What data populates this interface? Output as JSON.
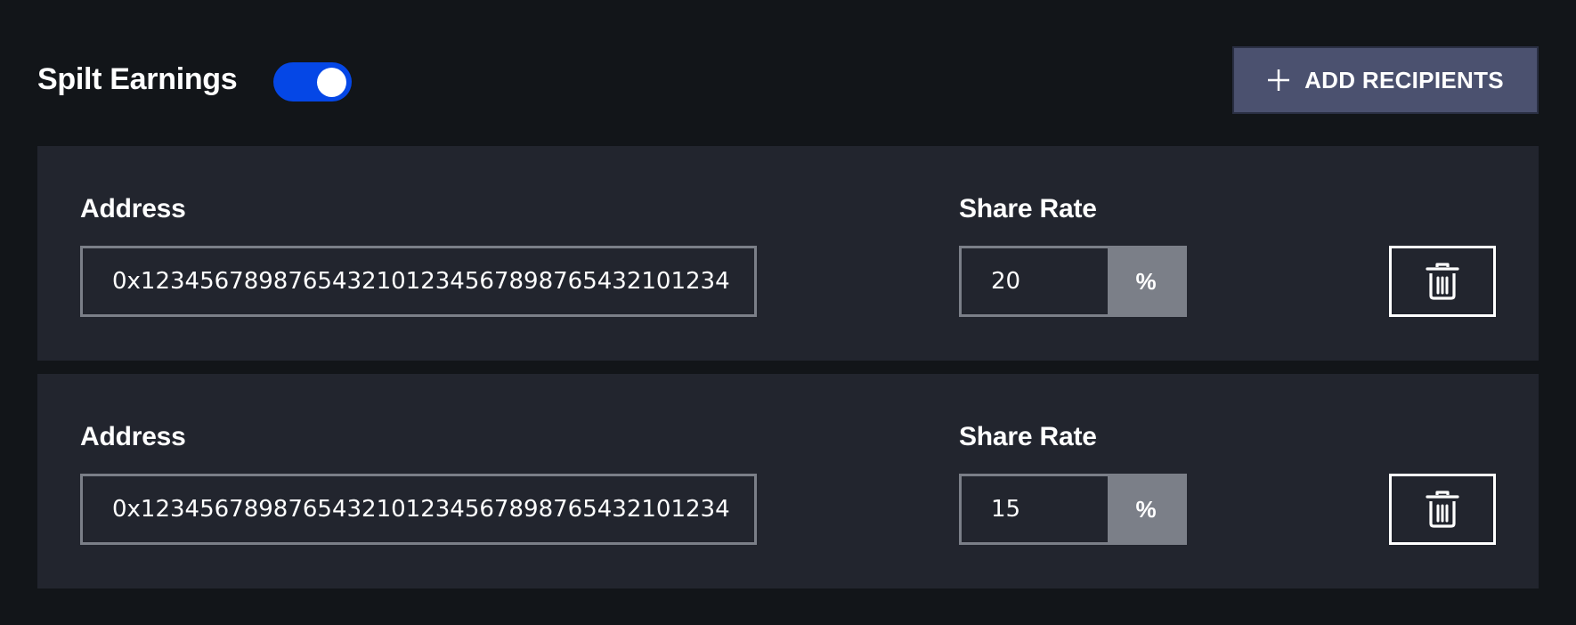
{
  "header": {
    "title": "Spilt Earnings",
    "toggle_on": true,
    "add_button_label": "ADD RECIPIENTS",
    "add_button_icon": "plus-icon"
  },
  "recipients": [
    {
      "address_label": "Address",
      "address_value": "0x12345678987654321012345678987654321012​34",
      "share_rate_label": "Share Rate",
      "share_rate_value": "20",
      "share_rate_unit": "%",
      "delete_icon": "trash-icon"
    },
    {
      "address_label": "Address",
      "address_value": "0x1234567898765432101234567898765432101234",
      "share_rate_label": "Share Rate",
      "share_rate_value": "15",
      "share_rate_unit": "%",
      "delete_icon": "trash-icon"
    }
  ],
  "colors": {
    "background": "#121519",
    "panel": "#22252e",
    "toggle_accent": "#0547e6",
    "add_button_bg": "#4b516f",
    "input_border": "#7b7f88"
  }
}
